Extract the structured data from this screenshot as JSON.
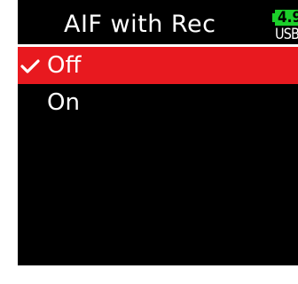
{
  "header": {
    "title": "AIF with Rec",
    "battery": {
      "level": "4.9",
      "source": "USB",
      "color": "#1ccf2a"
    }
  },
  "menu": {
    "items": [
      {
        "label": "Off",
        "selected": true,
        "checked": true
      },
      {
        "label": "On",
        "selected": false,
        "checked": false
      }
    ],
    "highlight_color": "#e8191f",
    "check_icon": "checkmark-icon"
  }
}
